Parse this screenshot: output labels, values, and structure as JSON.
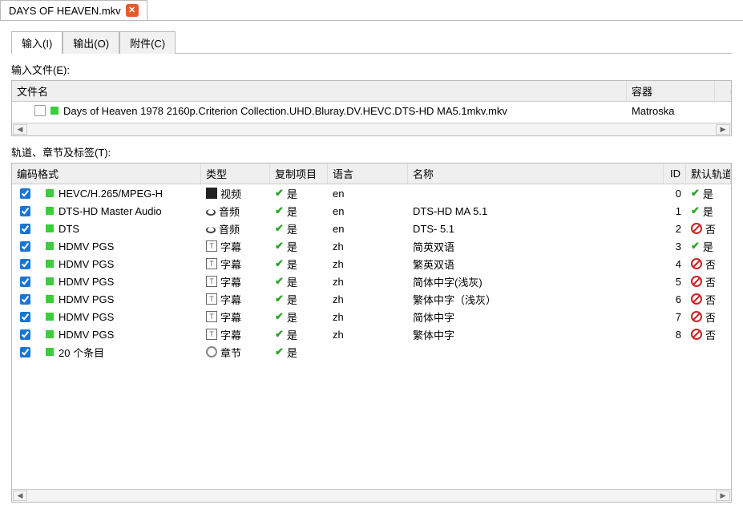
{
  "fileTab": {
    "title": "DAYS OF HEAVEN.mkv"
  },
  "subTabs": {
    "input": "输入(I)",
    "output": "输出(O)",
    "attachments": "附件(C)"
  },
  "labels": {
    "inputFiles": "输入文件(E):",
    "tracksChapters": "轨道、章节及标签(T):",
    "hdrName": "文件名",
    "hdrContainer": "容器",
    "hdrCodec": "编码格式",
    "hdrType": "类型",
    "hdrCopy": "复制项目",
    "hdrLang": "语言",
    "hdrTrackName": "名称",
    "hdrId": "ID",
    "hdrDefault": "默认轨道",
    "yes": "是",
    "no": "否"
  },
  "files": [
    {
      "name": "Days of Heaven 1978 2160p.Criterion Collection.UHD.Bluray.DV.HEVC.DTS-HD MA5.1mkv.mkv",
      "container": "Matroska"
    }
  ],
  "typeLabels": {
    "video": "视频",
    "audio": "音频",
    "subtitle": "字幕",
    "chapter": "章节"
  },
  "tracks": [
    {
      "codec": "HEVC/H.265/MPEG-H",
      "type": "video",
      "copy": true,
      "lang": "en",
      "name": "",
      "id": 0,
      "def": true
    },
    {
      "codec": "DTS-HD Master Audio",
      "type": "audio",
      "copy": true,
      "lang": "en",
      "name": "DTS-HD MA 5.1",
      "id": 1,
      "def": true
    },
    {
      "codec": "DTS",
      "type": "audio",
      "copy": true,
      "lang": "en",
      "name": "DTS- 5.1",
      "id": 2,
      "def": false
    },
    {
      "codec": "HDMV PGS",
      "type": "subtitle",
      "copy": true,
      "lang": "zh",
      "name": "简英双语",
      "id": 3,
      "def": true
    },
    {
      "codec": "HDMV PGS",
      "type": "subtitle",
      "copy": true,
      "lang": "zh",
      "name": "繁英双语",
      "id": 4,
      "def": false
    },
    {
      "codec": "HDMV PGS",
      "type": "subtitle",
      "copy": true,
      "lang": "zh",
      "name": "简体中字(浅灰)",
      "id": 5,
      "def": false
    },
    {
      "codec": "HDMV PGS",
      "type": "subtitle",
      "copy": true,
      "lang": "zh",
      "name": "繁体中字（浅灰）",
      "id": 6,
      "def": false
    },
    {
      "codec": "HDMV PGS",
      "type": "subtitle",
      "copy": true,
      "lang": "zh",
      "name": "简体中字",
      "id": 7,
      "def": false
    },
    {
      "codec": "HDMV PGS",
      "type": "subtitle",
      "copy": true,
      "lang": "zh",
      "name": "繁体中字",
      "id": 8,
      "def": false
    },
    {
      "codec": "20 个条目",
      "type": "chapter",
      "copy": true,
      "lang": "",
      "name": "",
      "id": "",
      "def": null
    }
  ]
}
